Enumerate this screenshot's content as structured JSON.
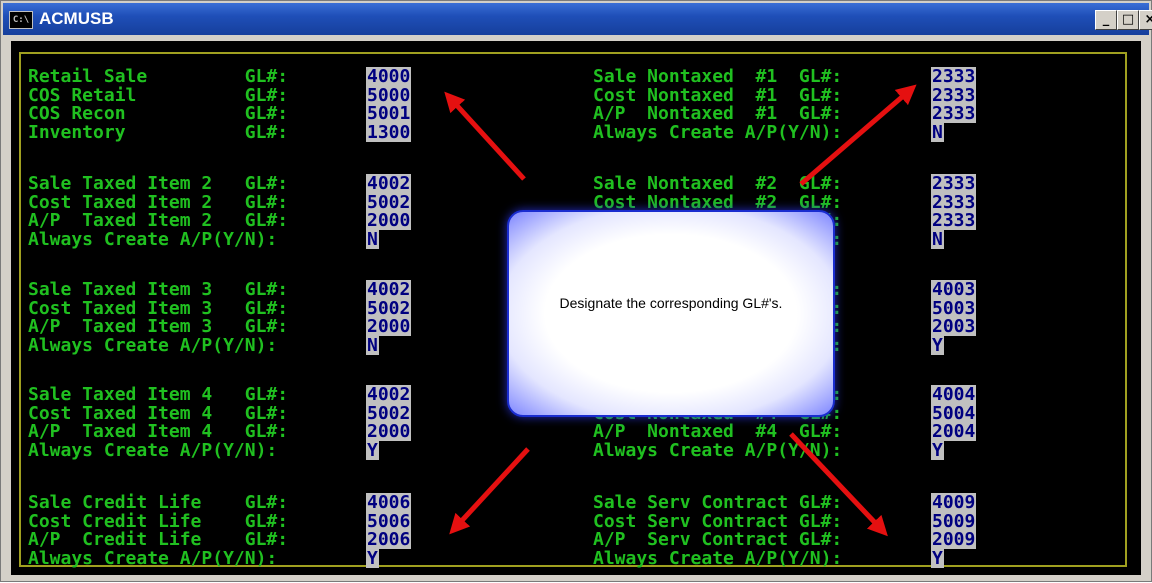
{
  "window": {
    "title": "ACMUSB",
    "icon_text": "C:\\",
    "buttons": {
      "minimize": "_",
      "maximize": "□",
      "close": "×"
    }
  },
  "left_rows": [
    {
      "label": "Retail Sale         GL#:",
      "value": "4000"
    },
    {
      "label": "COS Retail          GL#:",
      "value": "5000"
    },
    {
      "label": "COS Recon           GL#:",
      "value": "5001"
    },
    {
      "label": "Inventory           GL#:",
      "value": "1300"
    },
    {
      "label": "Sale Taxed Item 2   GL#:",
      "value": "4002"
    },
    {
      "label": "Cost Taxed Item 2   GL#:",
      "value": "5002"
    },
    {
      "label": "A/P  Taxed Item 2   GL#:",
      "value": "2000"
    },
    {
      "label": "Always Create A/P(Y/N):",
      "value": "N"
    },
    {
      "label": "Sale Taxed Item 3   GL#:",
      "value": "4002"
    },
    {
      "label": "Cost Taxed Item 3   GL#:",
      "value": "5002"
    },
    {
      "label": "A/P  Taxed Item 3   GL#:",
      "value": "2000"
    },
    {
      "label": "Always Create A/P(Y/N):",
      "value": "N"
    },
    {
      "label": "Sale Taxed Item 4   GL#:",
      "value": "4002"
    },
    {
      "label": "Cost Taxed Item 4   GL#:",
      "value": "5002"
    },
    {
      "label": "A/P  Taxed Item 4   GL#:",
      "value": "2000"
    },
    {
      "label": "Always Create A/P(Y/N):",
      "value": "Y"
    },
    {
      "label": "Sale Credit Life    GL#:",
      "value": "4006"
    },
    {
      "label": "Cost Credit Life    GL#:",
      "value": "5006"
    },
    {
      "label": "A/P  Credit Life    GL#:",
      "value": "2006"
    },
    {
      "label": "Always Create A/P(Y/N):",
      "value": "Y"
    }
  ],
  "right_rows": [
    {
      "label": "Sale Nontaxed  #1  GL#:",
      "value": "2333"
    },
    {
      "label": "Cost Nontaxed  #1  GL#:",
      "value": "2333"
    },
    {
      "label": "A/P  Nontaxed  #1  GL#:",
      "value": "2333"
    },
    {
      "label": "Always Create A/P(Y/N):",
      "value": "N"
    },
    {
      "label": "Sale Nontaxed  #2  GL#:",
      "value": "2333"
    },
    {
      "label": "Cost Nontaxed  #2  GL#:",
      "value": "2333"
    },
    {
      "label": "                   GL#:",
      "value": "2333"
    },
    {
      "label": "                 (Y/N):",
      "value": "N"
    },
    {
      "label": "                   GL#:",
      "value": "4003"
    },
    {
      "label": "                   GL#:",
      "value": "5003"
    },
    {
      "label": "                   GL#:",
      "value": "2003"
    },
    {
      "label": "                 (Y/N):",
      "value": "Y"
    },
    {
      "label": "                   GL#:",
      "value": "4004"
    },
    {
      "label": "Cost Nontaxed  #4  GL#:",
      "value": "5004"
    },
    {
      "label": "A/P  Nontaxed  #4  GL#:",
      "value": "2004"
    },
    {
      "label": "Always Create A/P(Y/N):",
      "value": "Y"
    },
    {
      "label": "Sale Serv Contract GL#:",
      "value": "4009"
    },
    {
      "label": "Cost Serv Contract GL#:",
      "value": "5009"
    },
    {
      "label": "A/P  Serv Contract GL#:",
      "value": "2009"
    },
    {
      "label": "Always Create A/P(Y/N):",
      "value": "Y"
    }
  ],
  "callout": {
    "text": "Designate the corresponding GL#'s."
  },
  "colors": {
    "label_green": "#20c020",
    "field_bg": "#c0c0c0",
    "field_text": "#000080",
    "arrow_red": "#e51010",
    "title_blue": "#1f4fb8"
  }
}
